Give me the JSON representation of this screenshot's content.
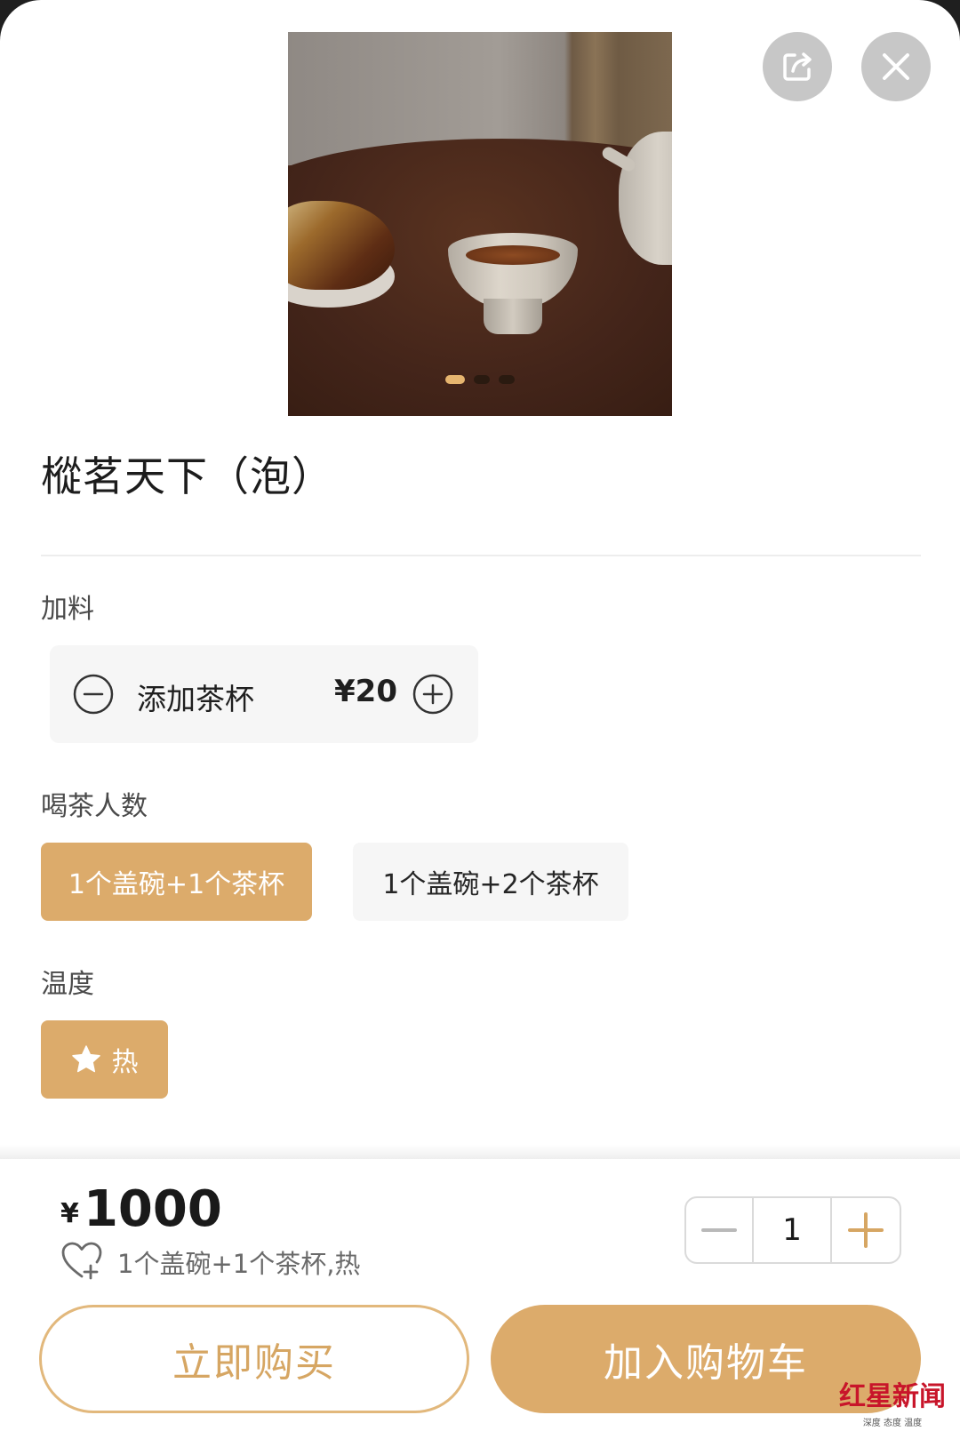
{
  "product": {
    "title": "樅茗天下（泡）",
    "image_carousel": {
      "slide_count": 3,
      "active_slide": 1
    }
  },
  "sections": {
    "addons_label": "加料",
    "people_label": "喝茶人数",
    "temperature_label": "温度"
  },
  "addon": {
    "name": "添加茶杯",
    "price": "¥20"
  },
  "people_options": [
    {
      "label": "1个盖碗+1个茶杯",
      "selected": true
    },
    {
      "label": "1个盖碗+2个茶杯",
      "selected": false
    }
  ],
  "temperature": {
    "label": "热",
    "selected": true
  },
  "footer": {
    "currency": "¥",
    "total": "1000",
    "summary": "1个盖碗+1个茶杯,热",
    "quantity": "1",
    "buy_now_label": "立即购买",
    "add_to_cart_label": "加入购物车"
  },
  "watermark": {
    "main": "红星新闻",
    "sub": "深度 态度 温度"
  },
  "colors": {
    "accent": "#dcab6b",
    "accent_text": "#d6a663",
    "option_bg": "#f6f6f6",
    "icon_button_bg": "#c7c7c7"
  },
  "icons": [
    "share-icon",
    "close-icon",
    "minus-circle-icon",
    "plus-circle-icon",
    "star-icon",
    "favorite-heart-icon",
    "minus-icon",
    "plus-icon"
  ]
}
